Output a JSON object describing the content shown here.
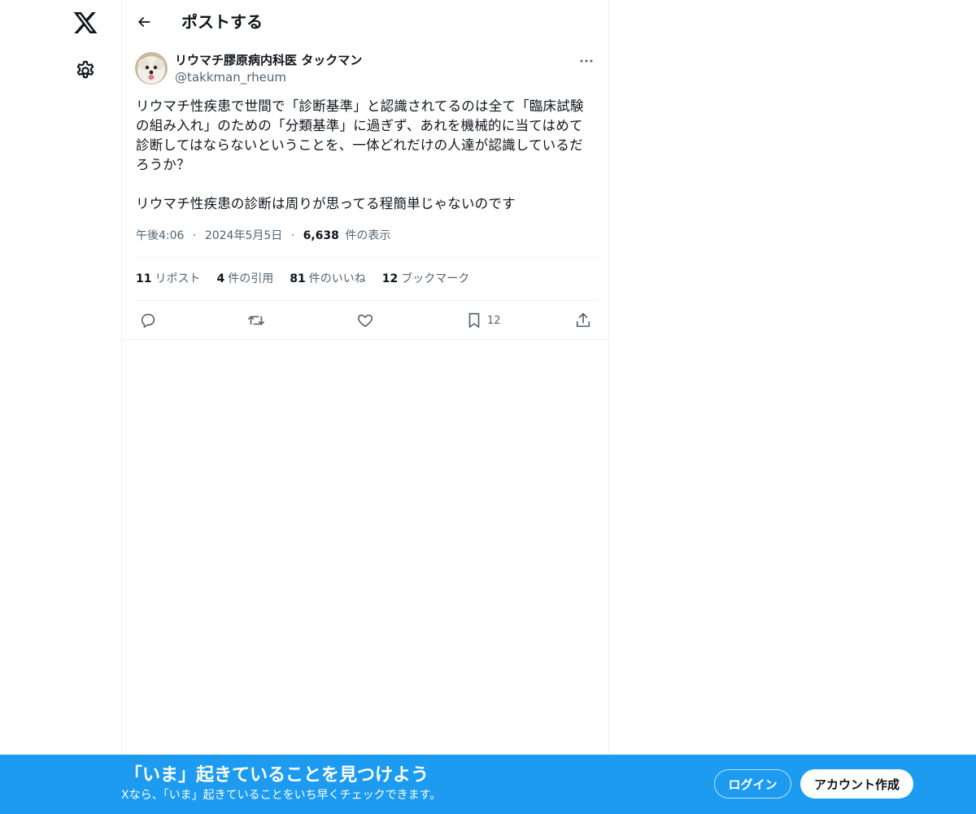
{
  "nav": {
    "logo_icon": "x-logo-icon",
    "settings_icon": "gear-icon"
  },
  "header": {
    "title": "ポストする",
    "back_icon": "arrow-left-icon"
  },
  "post": {
    "author_name": "リウマチ膠原病内科医 タックマン",
    "author_handle": "@takkman_rheum",
    "text": "リウマチ性疾患で世間で「診断基準」と認識されてるのは全て「臨床試験\nの組み入れ」のための「分類基準」に過ぎず、あれを機械的に当てはめて\n診断してはならないということを、一体どれだけの人達が認識しているだ\nろうか？\n\nリウマチ性疾患の診断は周りが思ってる程簡単じゃないのです",
    "time": "午後4:06",
    "separator": "·",
    "date": "2024年5月5日",
    "views_count": "6,638",
    "views_label": "件の表示"
  },
  "stats": {
    "reposts_count": "11",
    "reposts_label": "リポスト",
    "quotes_count": "4",
    "quotes_label": "件の引用",
    "likes_count": "81",
    "likes_label": "件のいいね",
    "bookmarks_count": "12",
    "bookmarks_label": "ブックマーク"
  },
  "actions": {
    "bookmark_count": "12"
  },
  "banner": {
    "title": "「いま」起きていることを見つけよう",
    "subtitle": "Xなら、「いま」起きていることをいち早くチェックできます。",
    "login_label": "ログイン",
    "signup_label": "アカウント作成"
  },
  "colors": {
    "accent": "#1d9bf0",
    "text_primary": "#0f1419",
    "text_secondary": "#536471",
    "border": "#eff3f4"
  }
}
